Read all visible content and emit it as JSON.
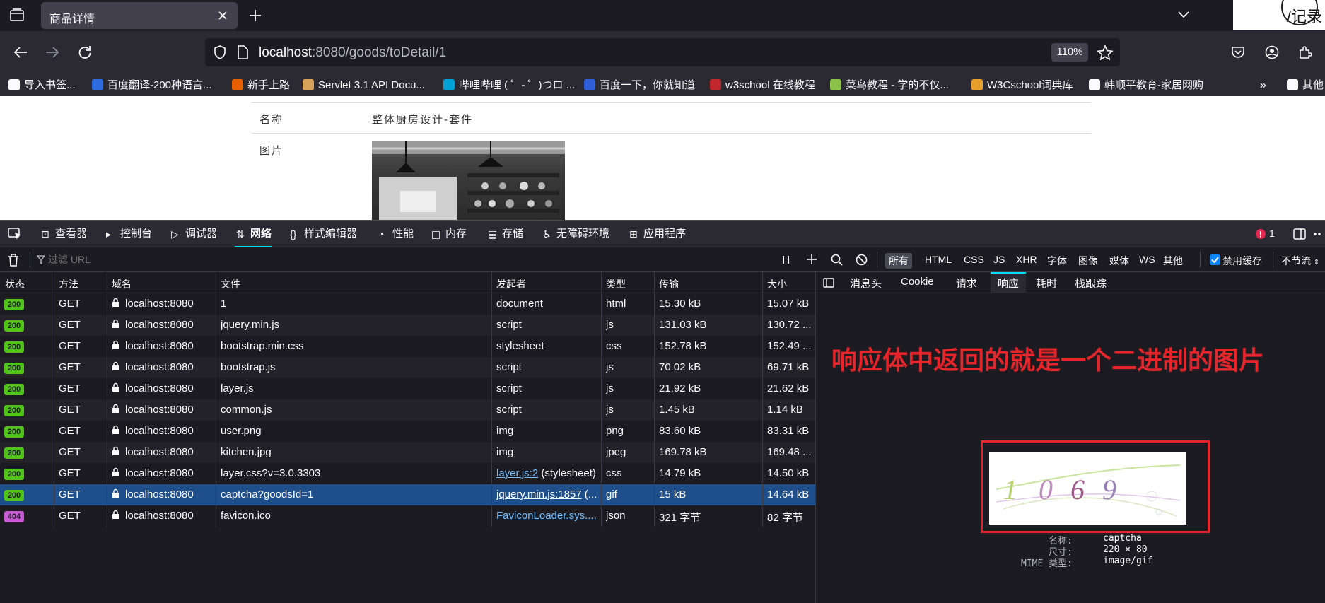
{
  "browser": {
    "tab_title": "商品详情",
    "pinned_text": "/记录",
    "url_host": "localhost",
    "url_rest": ":8080/goods/toDetail/1",
    "zoom": "110%"
  },
  "bookmarks": [
    {
      "label": "导入书签...",
      "color": "#fbfbfe"
    },
    {
      "label": "百度翻译-200种语言...",
      "color": "#2d6cdf"
    },
    {
      "label": "新手上路",
      "color": "#e66000"
    },
    {
      "label": "Servlet 3.1 API Docu...",
      "color": "#d9a35c"
    },
    {
      "label": "哔哩哔哩 ( ゜- ゜)つロ ...",
      "color": "#00a1d6"
    },
    {
      "label": "百度一下，你就知道",
      "color": "#2f5fd8"
    },
    {
      "label": "w3school 在线教程",
      "color": "#c0262c"
    },
    {
      "label": "菜鸟教程 - 学的不仅...",
      "color": "#8bc34a"
    },
    {
      "label": "W3Cschool词典库",
      "color": "#e9a02a"
    },
    {
      "label": "韩顺平教育-家居网购",
      "color": "#fbfbfe"
    },
    {
      "label": "其他",
      "color": "#fbfbfe"
    }
  ],
  "page": {
    "name_label": "名称",
    "name_value": "整体厨房设计-套件",
    "image_label": "图片"
  },
  "devtools": {
    "tabs": [
      "查看器",
      "控制台",
      "调试器",
      "网络",
      "样式编辑器",
      "性能",
      "内存",
      "存储",
      "无障碍环境",
      "应用程序"
    ],
    "selected_tab": "网络",
    "error_count": "1",
    "filter_placeholder": "过滤 URL",
    "type_filters": [
      "所有",
      "HTML",
      "CSS",
      "JS",
      "XHR",
      "字体",
      "图像",
      "媒体",
      "WS",
      "其他"
    ],
    "disable_cache": "禁用缓存",
    "throttle": "不节流"
  },
  "network": {
    "columns": [
      "状态",
      "方法",
      "域名",
      "文件",
      "发起者",
      "类型",
      "传输",
      "大小"
    ],
    "rows": [
      {
        "status": "200",
        "method": "GET",
        "domain": "localhost:8080",
        "file": "1",
        "initiator": "document",
        "initiator_extra": "",
        "type": "html",
        "transfer": "15.30 kB",
        "size": "15.07 kB"
      },
      {
        "status": "200",
        "method": "GET",
        "domain": "localhost:8080",
        "file": "jquery.min.js",
        "initiator": "script",
        "initiator_extra": "",
        "type": "js",
        "transfer": "131.03 kB",
        "size": "130.72 ..."
      },
      {
        "status": "200",
        "method": "GET",
        "domain": "localhost:8080",
        "file": "bootstrap.min.css",
        "initiator": "stylesheet",
        "initiator_extra": "",
        "type": "css",
        "transfer": "152.78 kB",
        "size": "152.49 ..."
      },
      {
        "status": "200",
        "method": "GET",
        "domain": "localhost:8080",
        "file": "bootstrap.js",
        "initiator": "script",
        "initiator_extra": "",
        "type": "js",
        "transfer": "70.02 kB",
        "size": "69.71 kB"
      },
      {
        "status": "200",
        "method": "GET",
        "domain": "localhost:8080",
        "file": "layer.js",
        "initiator": "script",
        "initiator_extra": "",
        "type": "js",
        "transfer": "21.92 kB",
        "size": "21.62 kB"
      },
      {
        "status": "200",
        "method": "GET",
        "domain": "localhost:8080",
        "file": "common.js",
        "initiator": "script",
        "initiator_extra": "",
        "type": "js",
        "transfer": "1.45 kB",
        "size": "1.14 kB"
      },
      {
        "status": "200",
        "method": "GET",
        "domain": "localhost:8080",
        "file": "user.png",
        "initiator": "img",
        "initiator_extra": "",
        "type": "png",
        "transfer": "83.60 kB",
        "size": "83.31 kB"
      },
      {
        "status": "200",
        "method": "GET",
        "domain": "localhost:8080",
        "file": "kitchen.jpg",
        "initiator": "img",
        "initiator_extra": "",
        "type": "jpeg",
        "transfer": "169.78 kB",
        "size": "169.48 ..."
      },
      {
        "status": "200",
        "method": "GET",
        "domain": "localhost:8080",
        "file": "layer.css?v=3.0.3303",
        "initiator": "layer.js:2",
        "initiator_extra": " (stylesheet)",
        "type": "css",
        "transfer": "14.79 kB",
        "size": "14.50 kB"
      },
      {
        "status": "200",
        "method": "GET",
        "domain": "localhost:8080",
        "file": "captcha?goodsId=1",
        "initiator": "jquery.min.js:1857",
        "initiator_extra": " (...",
        "type": "gif",
        "transfer": "15 kB",
        "size": "14.64 kB"
      },
      {
        "status": "404",
        "method": "GET",
        "domain": "localhost:8080",
        "file": "favicon.ico",
        "initiator": "FaviconLoader.sys....",
        "initiator_extra": "",
        "type": "json",
        "transfer": "321 字节",
        "size": "82 字节"
      }
    ],
    "selected_index": 9,
    "status_colors": {
      "200": "#51c41a",
      "404": "#c95ad6"
    }
  },
  "details": {
    "tabs": [
      "消息头",
      "Cookie",
      "请求",
      "响应",
      "耗时",
      "栈跟踪"
    ],
    "selected_tab": "响应",
    "annotation": "响应体中返回的就是一个二进制的图片",
    "captcha_digits": [
      "1",
      "0",
      "6",
      "9"
    ],
    "meta": [
      {
        "label": "名称:",
        "value": "captcha"
      },
      {
        "label": "尺寸:",
        "value": "220 × 80"
      },
      {
        "label": "MIME 类型:",
        "value": "image/gif"
      }
    ]
  },
  "accent_color": "#00ddff",
  "annotation_color": "#e5252a"
}
